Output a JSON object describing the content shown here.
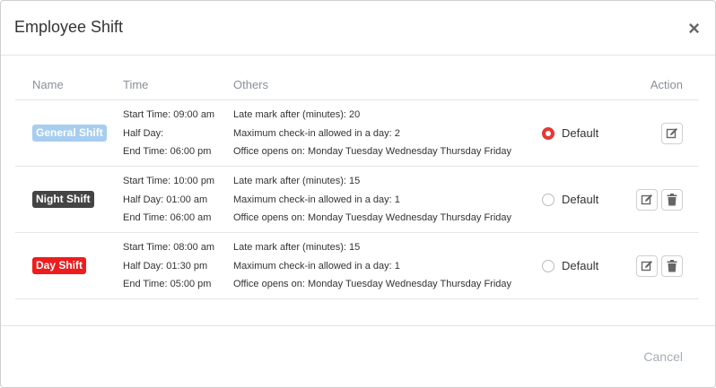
{
  "modal": {
    "title": "Employee Shift",
    "close_symbol": "×",
    "icons": {
      "close": "close-icon",
      "edit": "edit-icon",
      "delete": "trash-icon"
    }
  },
  "table": {
    "headers": {
      "name": "Name",
      "time": "Time",
      "others": "Others",
      "action": "Action"
    },
    "default_label": "Default",
    "rows": [
      {
        "name": "General Shift",
        "badge_color": "#a7cdf0",
        "start_time": "Start Time: 09:00 am",
        "half_day": "Half Day:",
        "end_time": "End Time: 06:00 pm",
        "late_mark": "Late mark after (minutes): 20",
        "max_checkin": "Maximum check-in allowed in a day: 2",
        "office_opens": "Office opens on: Monday Tuesday Wednesday Thursday Friday",
        "is_default": true
      },
      {
        "name": "Night Shift",
        "badge_color": "#444444",
        "start_time": "Start Time: 10:00 pm",
        "half_day": "Half Day: 01:00 am",
        "end_time": "End Time: 06:00 am",
        "late_mark": "Late mark after (minutes): 15",
        "max_checkin": "Maximum check-in allowed in a day: 1",
        "office_opens": "Office opens on: Monday Tuesday Wednesday Thursday Friday",
        "is_default": false
      },
      {
        "name": "Day Shift",
        "badge_color": "#ee1c1c",
        "start_time": "Start Time: 08:00 am",
        "half_day": "Half Day: 01:30 pm",
        "end_time": "End Time: 05:00 pm",
        "late_mark": "Late mark after (minutes): 15",
        "max_checkin": "Maximum check-in allowed in a day: 1",
        "office_opens": "Office opens on: Monday Tuesday Wednesday Thursday Friday",
        "is_default": false
      }
    ]
  },
  "footer": {
    "cancel_label": "Cancel"
  },
  "colors": {
    "radio_checked": "#e53935",
    "muted_text": "#8a8f99"
  }
}
